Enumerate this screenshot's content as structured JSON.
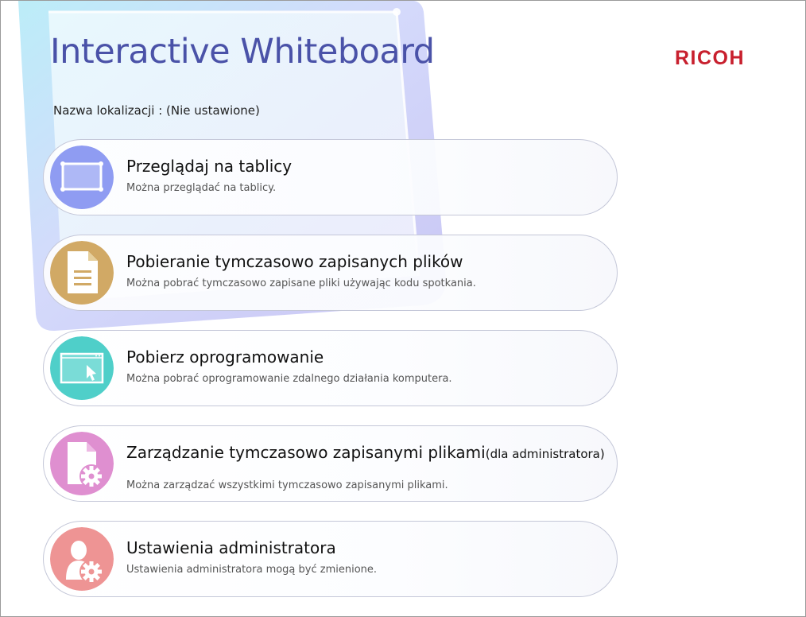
{
  "header": {
    "app_title": "Interactive Whiteboard",
    "brand": "RICOH",
    "location_label": "Nazwa lokalizacji : (Nie ustawione)"
  },
  "menu": [
    {
      "title": "Przeglądaj na tablicy",
      "description": "Można przeglądać na tablicy.",
      "icon": "whiteboard-icon",
      "color": "#8f9cf2"
    },
    {
      "title": "Pobieranie tymczasowo zapisanych plików",
      "description": "Można pobrać tymczasowo zapisane pliki używając kodu spotkania.",
      "icon": "document-icon",
      "color": "#d1a965"
    },
    {
      "title": "Pobierz oprogramowanie",
      "description": "Można pobrać oprogramowanie zdalnego działania komputera.",
      "icon": "remote-screen-icon",
      "color": "#4fcfc9"
    },
    {
      "title": "Zarządzanie tymczasowo zapisanymi plikami",
      "title_suffix": "(dla administratora)",
      "description": "Można zarządzać wszystkimi tymczasowo zapisanymi plikami.",
      "icon": "file-gear-icon",
      "color": "#df8fd0"
    },
    {
      "title": "Ustawienia administratora",
      "description": "Ustawienia administratora mogą być zmienione.",
      "icon": "admin-gear-icon",
      "color": "#ee9494"
    }
  ]
}
